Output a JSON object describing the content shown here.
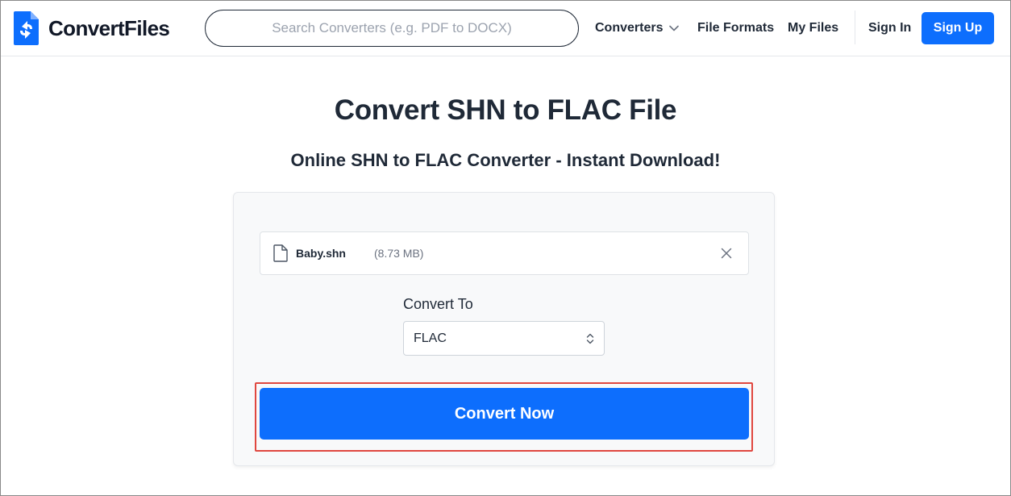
{
  "header": {
    "brand": "ConvertFiles",
    "search_placeholder": "Search Converters (e.g. PDF to DOCX)",
    "nav": {
      "converters": "Converters",
      "file_formats": "File Formats",
      "my_files": "My Files",
      "sign_in": "Sign In",
      "sign_up": "Sign Up"
    }
  },
  "main": {
    "title": "Convert SHN to FLAC File",
    "subtitle": "Online SHN to FLAC Converter - Instant Download!",
    "file": {
      "name": "Baby.shn",
      "size": "(8.73 MB)"
    },
    "convert_to_label": "Convert To",
    "convert_to_value": "FLAC",
    "convert_button": "Convert Now"
  },
  "colors": {
    "primary": "#0d6efd",
    "highlight": "#e0473f",
    "text": "#1f2937"
  },
  "icons": [
    "logo-icon",
    "chevron-down-icon",
    "file-icon",
    "close-icon",
    "select-arrows-icon"
  ]
}
